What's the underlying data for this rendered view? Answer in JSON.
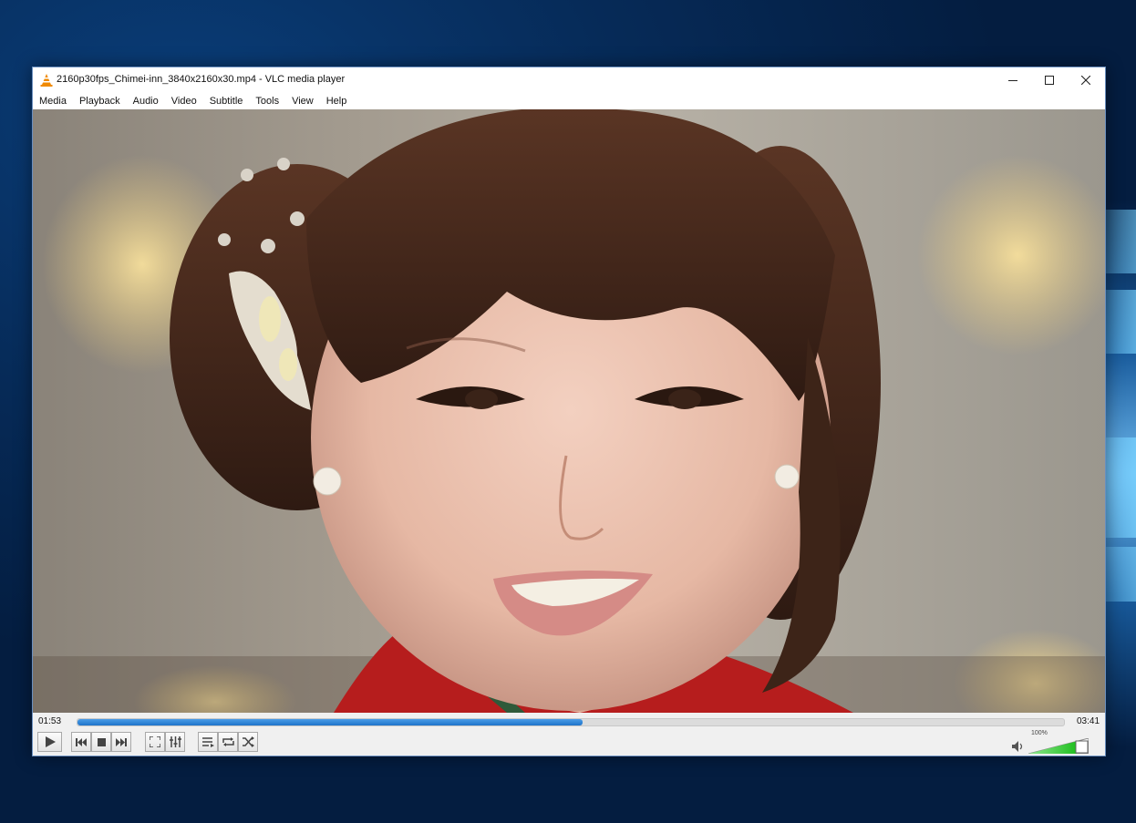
{
  "window": {
    "title": "2160p30fps_Chimei-inn_3840x2160x30.mp4 - VLC media player",
    "icon": "vlc-cone-icon",
    "controls": [
      "minimize-icon",
      "maximize-icon",
      "close-icon"
    ]
  },
  "menu": [
    "Media",
    "Playback",
    "Audio",
    "Video",
    "Subtitle",
    "Tools",
    "View",
    "Help"
  ],
  "playback": {
    "elapsed": "01:53",
    "total": "03:41",
    "progress_fraction": 0.512
  },
  "volume": {
    "label": "100%",
    "level_fraction": 0.8
  },
  "buttons": [
    "play-icon",
    "previous-icon",
    "stop-icon",
    "next-icon",
    "fullscreen-icon",
    "extended-settings-icon",
    "playlist-icon",
    "loop-icon",
    "shuffle-icon"
  ],
  "colors": {
    "seek_fill": "#1f73c9",
    "volume_fill": "#2ecc2e",
    "vlc_orange": "#f08a00"
  }
}
